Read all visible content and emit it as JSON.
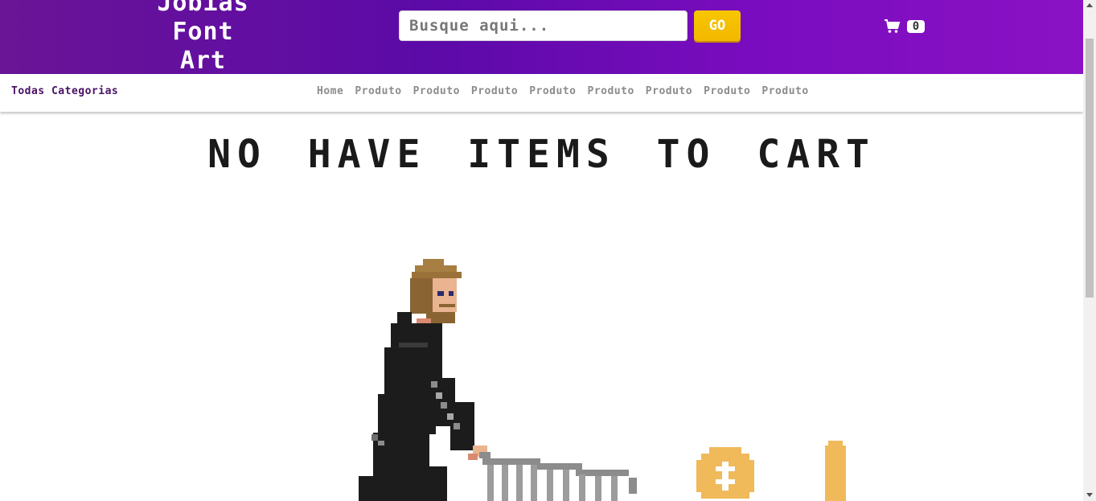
{
  "header": {
    "logo_lines": [
      "Jobias",
      "Font",
      "Art"
    ],
    "search_placeholder": "Busque aqui...",
    "go_label": "GO",
    "cart_icon": "shopping-cart-icon",
    "cart_count": "0"
  },
  "nav": {
    "categories_label": "Todas Categorias",
    "links": [
      "Home",
      "Produto",
      "Produto",
      "Produto",
      "Produto",
      "Produto",
      "Produto",
      "Produto",
      "Produto"
    ]
  },
  "main": {
    "title": "NO HAVE ITEMS TO CART"
  },
  "colors": {
    "header_gradient": [
      "#6a1496",
      "#8a12c4"
    ],
    "go_button": "#f2b800",
    "coin": "#f0b95a",
    "character_body": "#1c1c1c"
  }
}
